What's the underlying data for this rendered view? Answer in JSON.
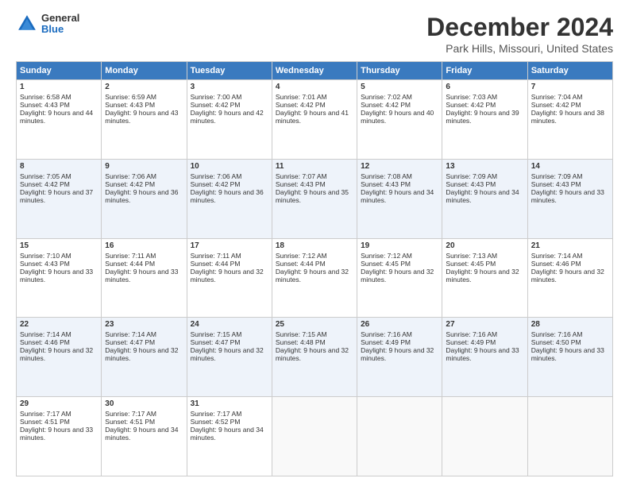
{
  "header": {
    "logo": {
      "general": "General",
      "blue": "Blue"
    },
    "title": "December 2024",
    "subtitle": "Park Hills, Missouri, United States"
  },
  "calendar": {
    "headers": [
      "Sunday",
      "Monday",
      "Tuesday",
      "Wednesday",
      "Thursday",
      "Friday",
      "Saturday"
    ],
    "weeks": [
      [
        null,
        {
          "day": 2,
          "sunrise": "6:59 AM",
          "sunset": "4:43 PM",
          "daylight": "9 hours and 43 minutes."
        },
        {
          "day": 3,
          "sunrise": "7:00 AM",
          "sunset": "4:42 PM",
          "daylight": "9 hours and 42 minutes."
        },
        {
          "day": 4,
          "sunrise": "7:01 AM",
          "sunset": "4:42 PM",
          "daylight": "9 hours and 41 minutes."
        },
        {
          "day": 5,
          "sunrise": "7:02 AM",
          "sunset": "4:42 PM",
          "daylight": "9 hours and 40 minutes."
        },
        {
          "day": 6,
          "sunrise": "7:03 AM",
          "sunset": "4:42 PM",
          "daylight": "9 hours and 39 minutes."
        },
        {
          "day": 7,
          "sunrise": "7:04 AM",
          "sunset": "4:42 PM",
          "daylight": "9 hours and 38 minutes."
        }
      ],
      [
        {
          "day": 1,
          "sunrise": "6:58 AM",
          "sunset": "4:43 PM",
          "daylight": "9 hours and 44 minutes."
        },
        null,
        null,
        null,
        null,
        null,
        null
      ],
      [
        {
          "day": 8,
          "sunrise": "7:05 AM",
          "sunset": "4:42 PM",
          "daylight": "9 hours and 37 minutes."
        },
        {
          "day": 9,
          "sunrise": "7:06 AM",
          "sunset": "4:42 PM",
          "daylight": "9 hours and 36 minutes."
        },
        {
          "day": 10,
          "sunrise": "7:06 AM",
          "sunset": "4:42 PM",
          "daylight": "9 hours and 36 minutes."
        },
        {
          "day": 11,
          "sunrise": "7:07 AM",
          "sunset": "4:43 PM",
          "daylight": "9 hours and 35 minutes."
        },
        {
          "day": 12,
          "sunrise": "7:08 AM",
          "sunset": "4:43 PM",
          "daylight": "9 hours and 34 minutes."
        },
        {
          "day": 13,
          "sunrise": "7:09 AM",
          "sunset": "4:43 PM",
          "daylight": "9 hours and 34 minutes."
        },
        {
          "day": 14,
          "sunrise": "7:09 AM",
          "sunset": "4:43 PM",
          "daylight": "9 hours and 33 minutes."
        }
      ],
      [
        {
          "day": 15,
          "sunrise": "7:10 AM",
          "sunset": "4:43 PM",
          "daylight": "9 hours and 33 minutes."
        },
        {
          "day": 16,
          "sunrise": "7:11 AM",
          "sunset": "4:44 PM",
          "daylight": "9 hours and 33 minutes."
        },
        {
          "day": 17,
          "sunrise": "7:11 AM",
          "sunset": "4:44 PM",
          "daylight": "9 hours and 32 minutes."
        },
        {
          "day": 18,
          "sunrise": "7:12 AM",
          "sunset": "4:44 PM",
          "daylight": "9 hours and 32 minutes."
        },
        {
          "day": 19,
          "sunrise": "7:12 AM",
          "sunset": "4:45 PM",
          "daylight": "9 hours and 32 minutes."
        },
        {
          "day": 20,
          "sunrise": "7:13 AM",
          "sunset": "4:45 PM",
          "daylight": "9 hours and 32 minutes."
        },
        {
          "day": 21,
          "sunrise": "7:14 AM",
          "sunset": "4:46 PM",
          "daylight": "9 hours and 32 minutes."
        }
      ],
      [
        {
          "day": 22,
          "sunrise": "7:14 AM",
          "sunset": "4:46 PM",
          "daylight": "9 hours and 32 minutes."
        },
        {
          "day": 23,
          "sunrise": "7:14 AM",
          "sunset": "4:47 PM",
          "daylight": "9 hours and 32 minutes."
        },
        {
          "day": 24,
          "sunrise": "7:15 AM",
          "sunset": "4:47 PM",
          "daylight": "9 hours and 32 minutes."
        },
        {
          "day": 25,
          "sunrise": "7:15 AM",
          "sunset": "4:48 PM",
          "daylight": "9 hours and 32 minutes."
        },
        {
          "day": 26,
          "sunrise": "7:16 AM",
          "sunset": "4:49 PM",
          "daylight": "9 hours and 32 minutes."
        },
        {
          "day": 27,
          "sunrise": "7:16 AM",
          "sunset": "4:49 PM",
          "daylight": "9 hours and 33 minutes."
        },
        {
          "day": 28,
          "sunrise": "7:16 AM",
          "sunset": "4:50 PM",
          "daylight": "9 hours and 33 minutes."
        }
      ],
      [
        {
          "day": 29,
          "sunrise": "7:17 AM",
          "sunset": "4:51 PM",
          "daylight": "9 hours and 33 minutes."
        },
        {
          "day": 30,
          "sunrise": "7:17 AM",
          "sunset": "4:51 PM",
          "daylight": "9 hours and 34 minutes."
        },
        {
          "day": 31,
          "sunrise": "7:17 AM",
          "sunset": "4:52 PM",
          "daylight": "9 hours and 34 minutes."
        },
        null,
        null,
        null,
        null
      ]
    ]
  }
}
